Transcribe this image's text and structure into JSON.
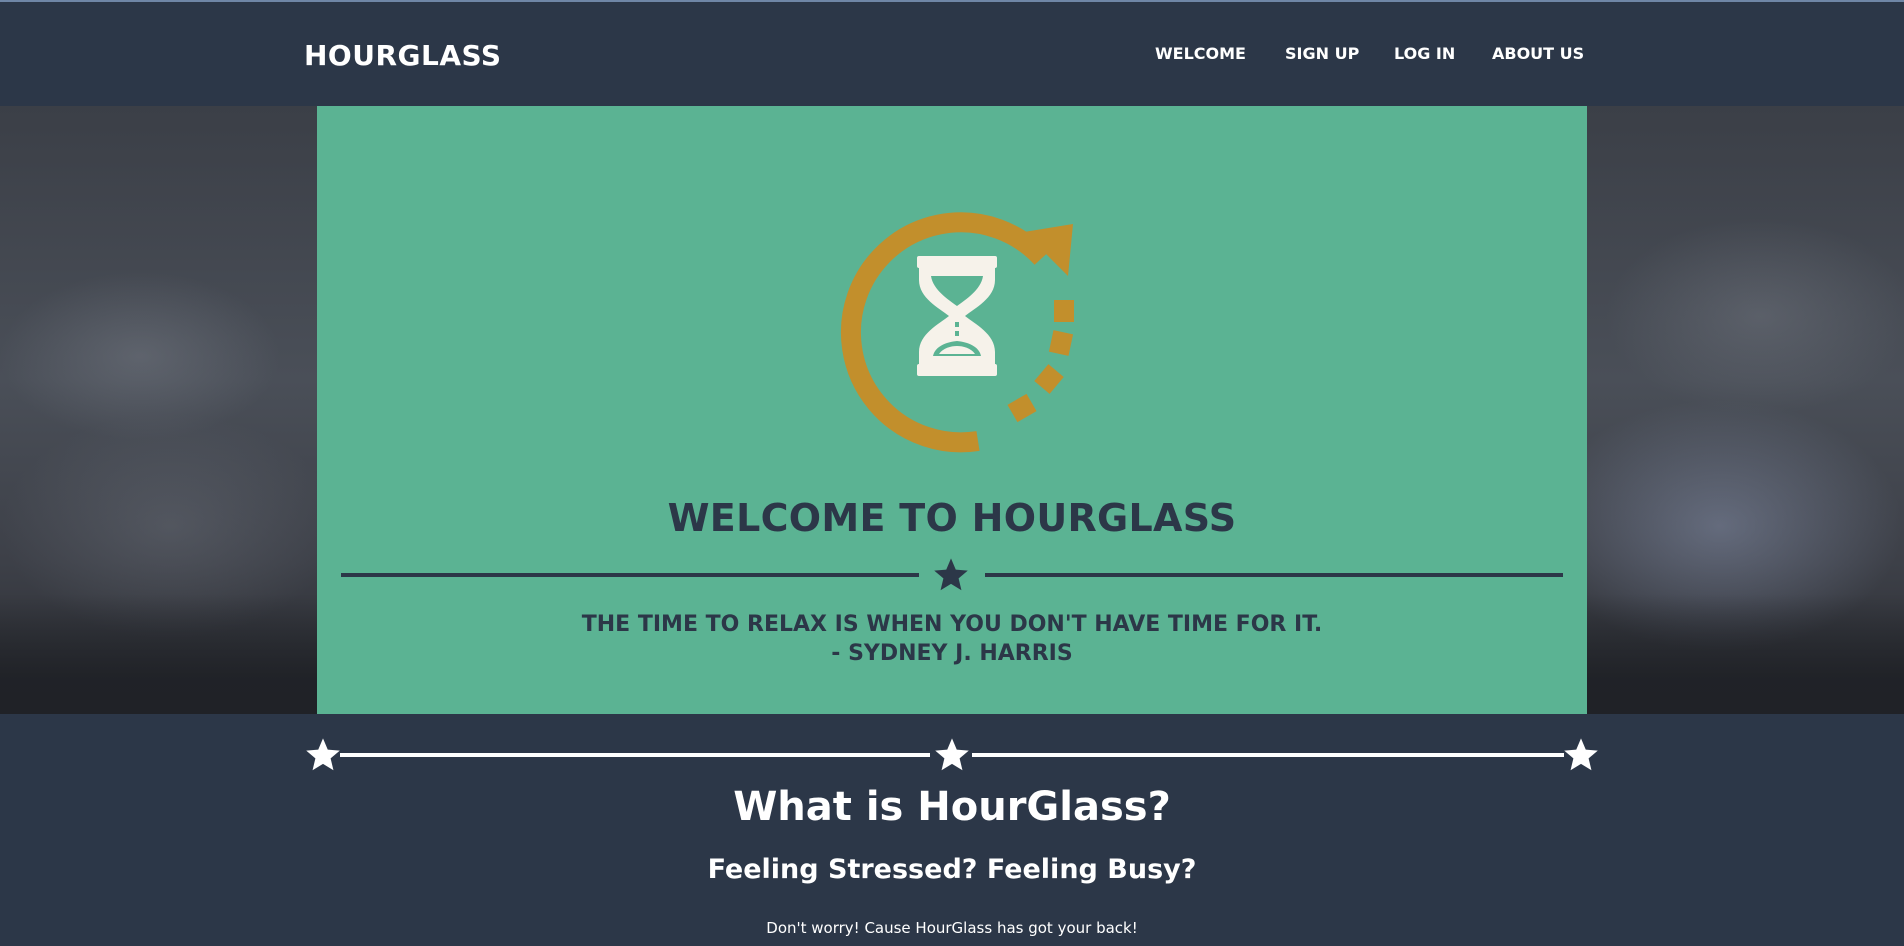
{
  "nav": {
    "brand": "HOURGLASS",
    "links": [
      "WELCOME",
      "SIGN UP",
      "LOG IN",
      "ABOUT US"
    ]
  },
  "masthead": {
    "logo_icon": "hourglass-refresh-icon",
    "title": "WELCOME TO HOURGLASS",
    "divider_icon": "star-icon",
    "quote": "THE TIME TO RELAX IS WHEN YOU DON'T HAVE TIME FOR IT.",
    "attribution": "- SYDNEY J. HARRIS"
  },
  "about": {
    "divider_icon": "star-icon",
    "title": "What is HourGlass?",
    "subtitle": "Feeling Stressed? Feeling Busy?",
    "text": "Don't worry! Cause HourGlass has got your back!"
  },
  "colors": {
    "navy": "#2c3748",
    "mint": "#5bb393",
    "gold": "#c28f2c",
    "cream": "#f6f2ea"
  }
}
